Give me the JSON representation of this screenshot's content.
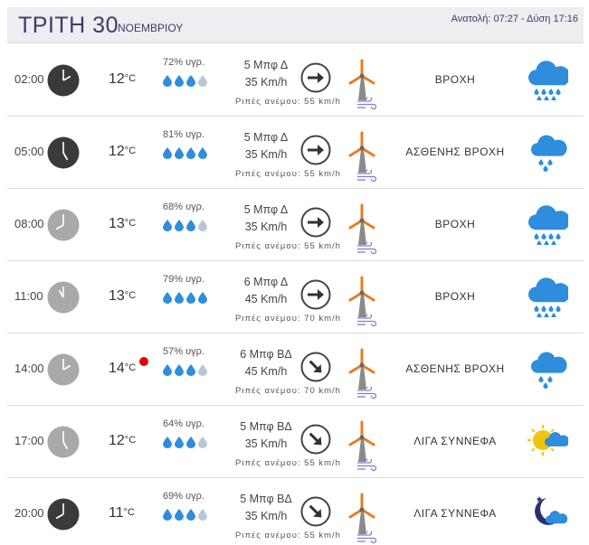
{
  "header": {
    "day": "ΤΡΙΤΗ 30",
    "month": "ΝΟΕΜΒΡΙΟΥ",
    "sun": "Ανατολή: 07:27  - Δύση 17:16"
  },
  "gust_label": "Ριπές ανέμου:",
  "rows": [
    {
      "time": "02:00",
      "hour": 2,
      "clock": "dark",
      "temp": "12",
      "unit": "°C",
      "hot": false,
      "humidity": "72% υγρ.",
      "drops_filled": 3,
      "wind_force": "5 Μπφ Δ",
      "wind_speed": "35 Km/h",
      "wind_dir": "W",
      "gusts": "Ριπές ανέμου: 55 km/h",
      "condition": "ΒΡΟΧΗ",
      "icon": "rain-cloud-icon"
    },
    {
      "time": "05:00",
      "hour": 5,
      "clock": "dark",
      "temp": "12",
      "unit": "°C",
      "hot": false,
      "humidity": "81% υγρ.",
      "drops_filled": 4,
      "wind_force": "5 Μπφ Δ",
      "wind_speed": "35 Km/h",
      "wind_dir": "W",
      "gusts": "Ριπές ανέμου: 55 km/h",
      "condition": "ΑΣΘΕΝΗΣ ΒΡΟΧΗ",
      "icon": "light-rain-cloud-icon"
    },
    {
      "time": "08:00",
      "hour": 8,
      "clock": "light",
      "temp": "13",
      "unit": "°C",
      "hot": false,
      "humidity": "68% υγρ.",
      "drops_filled": 3,
      "wind_force": "5 Μπφ Δ",
      "wind_speed": "35 Km/h",
      "wind_dir": "W",
      "gusts": "Ριπές ανέμου: 55 km/h",
      "condition": "ΒΡΟΧΗ",
      "icon": "rain-cloud-icon"
    },
    {
      "time": "11:00",
      "hour": 11,
      "clock": "light",
      "temp": "13",
      "unit": "°C",
      "hot": false,
      "humidity": "79% υγρ.",
      "drops_filled": 4,
      "wind_force": "6 Μπφ Δ",
      "wind_speed": "45 Km/h",
      "wind_dir": "W",
      "gusts": "Ριπές ανέμου: 70 km/h",
      "condition": "ΒΡΟΧΗ",
      "icon": "rain-cloud-icon"
    },
    {
      "time": "14:00",
      "hour": 14,
      "clock": "light",
      "temp": "14",
      "unit": "°C",
      "hot": true,
      "humidity": "57% υγρ.",
      "drops_filled": 3,
      "wind_force": "6 Μπφ ΒΔ",
      "wind_speed": "45 Km/h",
      "wind_dir": "NW",
      "gusts": "Ριπές ανέμου: 70 km/h",
      "condition": "ΑΣΘΕΝΗΣ ΒΡΟΧΗ",
      "icon": "light-rain-cloud-icon"
    },
    {
      "time": "17:00",
      "hour": 17,
      "clock": "light",
      "temp": "12",
      "unit": "°C",
      "hot": false,
      "humidity": "64% υγρ.",
      "drops_filled": 3,
      "wind_force": "5 Μπφ ΒΔ",
      "wind_speed": "35 Km/h",
      "wind_dir": "NW",
      "gusts": "Ριπές ανέμου: 55 km/h",
      "condition": "ΛΙΓΑ ΣΥΝΝΕΦΑ",
      "icon": "sun-cloud-icon"
    },
    {
      "time": "20:00",
      "hour": 20,
      "clock": "dark",
      "temp": "11",
      "unit": "°C",
      "hot": false,
      "humidity": "69% υγρ.",
      "drops_filled": 3,
      "wind_force": "5 Μπφ ΒΔ",
      "wind_speed": "35 Km/h",
      "wind_dir": "NW",
      "gusts": "Ριπές ανέμου: 55 km/h",
      "condition": "ΛΙΓΑ ΣΥΝΝΕΦΑ",
      "icon": "moon-cloud-icon"
    }
  ],
  "colors": {
    "accent_blue": "#2e8ddc",
    "drop_empty": "#b9c7d4",
    "clock_dark": "#3a3a3a",
    "clock_light": "#a9a9a9",
    "header_bg": "#ededf2",
    "header_text": "#3c3c66",
    "hot_dot": "#e60000",
    "windmill_blade": "#e67e22",
    "gust_icon": "#7b7fd1",
    "sun": "#f2c20f",
    "moon": "#2b2f73"
  }
}
